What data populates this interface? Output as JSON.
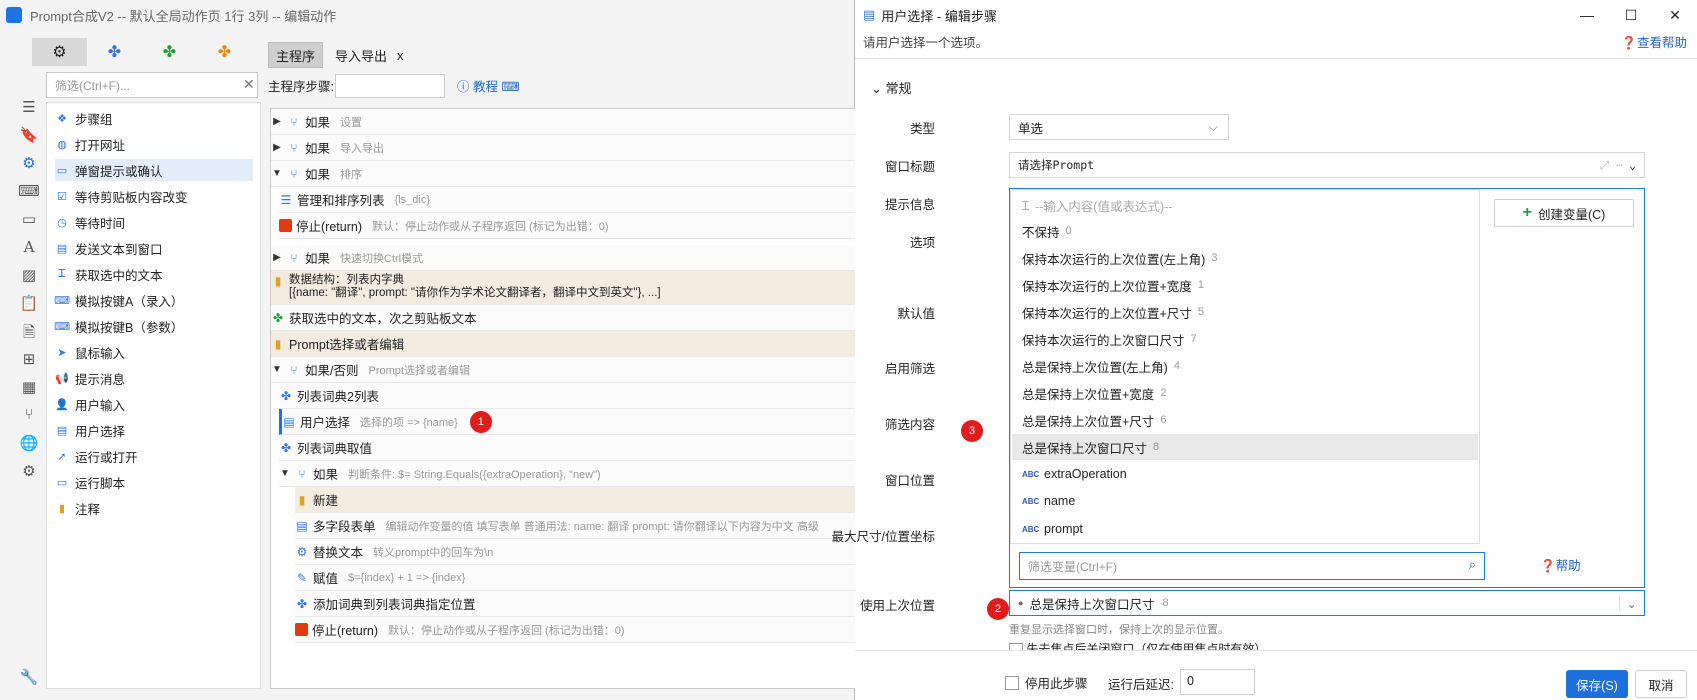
{
  "left_title": "Prompt合成V2 -- 默认全局动作页 1行 3列 -- 编辑动作",
  "filter_placeholder": "筛选(Ctrl+F)...",
  "sidebar_items": [
    "步骤组",
    "打开网址",
    "弹窗提示或确认",
    "等待剪贴板内容改变",
    "等待时间",
    "发送文本到窗口",
    "获取选中的文本",
    "模拟按键A（录入）",
    "模拟按键B（参数）",
    "鼠标输入",
    "提示消息",
    "用户输入",
    "用户选择",
    "运行或打开",
    "运行脚本",
    "注释"
  ],
  "main_tabs": [
    "主程序",
    "导入导出"
  ],
  "main_steps_label": "主程序步骤:",
  "tutorial": "教程",
  "tree": [
    {
      "label": "如果",
      "desc": "设置"
    },
    {
      "label": "如果",
      "desc": "导入导出"
    },
    {
      "label": "如果",
      "desc": "排序"
    },
    {
      "label": "管理和排序列表",
      "desc": "{ls_dic}"
    },
    {
      "label": "停止(return)",
      "desc": "默认：停止动作或从子程序返回 (标记为出错：0)"
    },
    {
      "label": "如果",
      "desc": "快速切换Ctrl模式"
    },
    {
      "label": "数据结构：列表内字典",
      "desc": "[{name: \"翻译\", prompt: \"请你作为学术论文翻译者，翻译中文到英文\"}, ...]"
    },
    {
      "label": "获取选中的文本，次之剪贴板文本",
      "desc": ""
    },
    {
      "label": "Prompt选择或者编辑",
      "desc": ""
    },
    {
      "label": "如果/否则",
      "desc": "Prompt选择或者编辑"
    },
    {
      "label": "列表词典2列表",
      "desc": ""
    },
    {
      "label": "用户选择",
      "desc": "选择的项 => {name}"
    },
    {
      "label": "列表词典取值",
      "desc": ""
    },
    {
      "label": "如果",
      "desc": "判断条件: $= String.Equals({extraOperation}, \"new\")"
    },
    {
      "label": "新建",
      "desc": ""
    },
    {
      "label": "多字段表单",
      "desc": "编辑动作变量的值 填写表单 普通用法:    name: 翻译  prompt: 请你翻译以下内容为中文    高级"
    },
    {
      "label": "替换文本",
      "desc": "转义prompt中的回车为\\n"
    },
    {
      "label": "赋值",
      "desc": "$={index} + 1 => {index}"
    },
    {
      "label": "添加词典到列表词典指定位置",
      "desc": ""
    },
    {
      "label": "停止(return)",
      "desc": "默认：停止动作或从子程序返回 (标记为出错：0)"
    }
  ],
  "badges": [
    "1",
    "2",
    "3"
  ],
  "dialog_title": "用户选择 - 编辑步骤",
  "dialog_desc": "请用户选择一个选项。",
  "help_link": "查看帮助",
  "section": "常规",
  "labels": [
    "类型",
    "窗口标题",
    "提示信息",
    "选项",
    "默认值",
    "启用筛选",
    "筛选内容",
    "窗口位置",
    "最大尺寸/位置坐标",
    "使用上次位置"
  ],
  "type_value": "单选",
  "window_title_value": "请选择Prompt",
  "popup_placeholder": "--输入内容(值或表达式)--",
  "popup_items": [
    {
      "text": "不保持",
      "num": "0"
    },
    {
      "text": "保持本次运行的上次位置(左上角)",
      "num": "3"
    },
    {
      "text": "保持本次运行的上次位置+宽度",
      "num": "1"
    },
    {
      "text": "保持本次运行的上次位置+尺寸",
      "num": "5"
    },
    {
      "text": "保持本次运行的上次窗口尺寸",
      "num": "7"
    },
    {
      "text": "总是保持上次位置(左上角)",
      "num": "4"
    },
    {
      "text": "总是保持上次位置+宽度",
      "num": "2"
    },
    {
      "text": "总是保持上次位置+尺寸",
      "num": "6"
    },
    {
      "text": "总是保持上次窗口尺寸",
      "num": "8"
    }
  ],
  "popup_vars": [
    "extraOperation",
    "name",
    "prompt"
  ],
  "create_var": "创建变量(C)",
  "var_filter": "筛选变量(Ctrl+F)",
  "popup_help": "帮助",
  "last_pos_value": "总是保持上次窗口尺寸",
  "last_pos_num": "8",
  "last_pos_hint": "重复显示选择窗口时，保持上次的显示位置。",
  "lose_focus": "失去焦点后关闭窗口（仅在使用焦点时有效）",
  "disable_step": "停用此步骤",
  "delay_label": "运行后延迟:",
  "delay_value": "0",
  "save": "保存(S)",
  "cancel": "取消"
}
